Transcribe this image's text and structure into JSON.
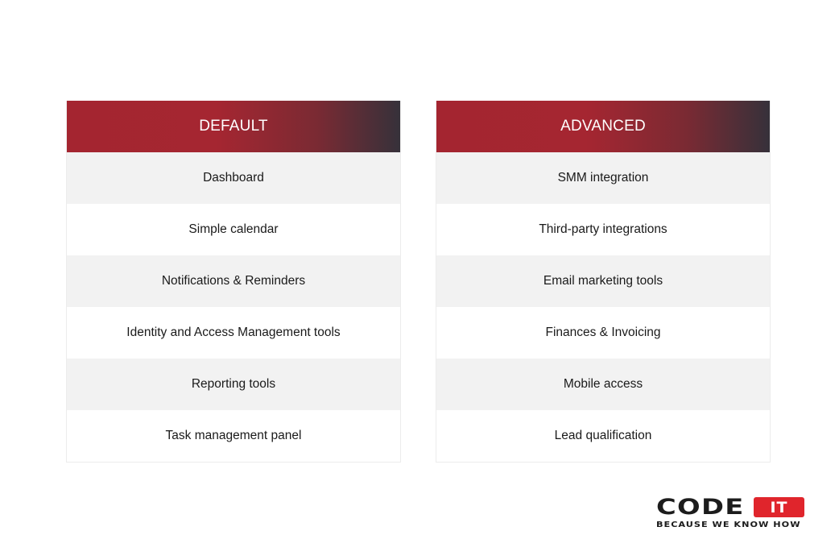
{
  "tables": [
    {
      "header": "DEFAULT",
      "rows": [
        "Dashboard",
        "Simple calendar",
        "Notifications & Reminders",
        "Identity and Access Management tools",
        "Reporting tools",
        "Task management panel"
      ]
    },
    {
      "header": "ADVANCED",
      "rows": [
        "SMM integration",
        "Third-party integrations",
        "Email marketing tools",
        "Finances & Invoicing",
        "Mobile access",
        "Lead qualification"
      ]
    }
  ],
  "logo": {
    "brand": "CODE",
    "badge": "IT",
    "tagline": "BECAUSE WE KNOW HOW"
  },
  "colors": {
    "header_red": "#a42530",
    "header_dark": "#36313a",
    "logo_red": "#e0252c",
    "row_alt": "#f2f2f2"
  }
}
